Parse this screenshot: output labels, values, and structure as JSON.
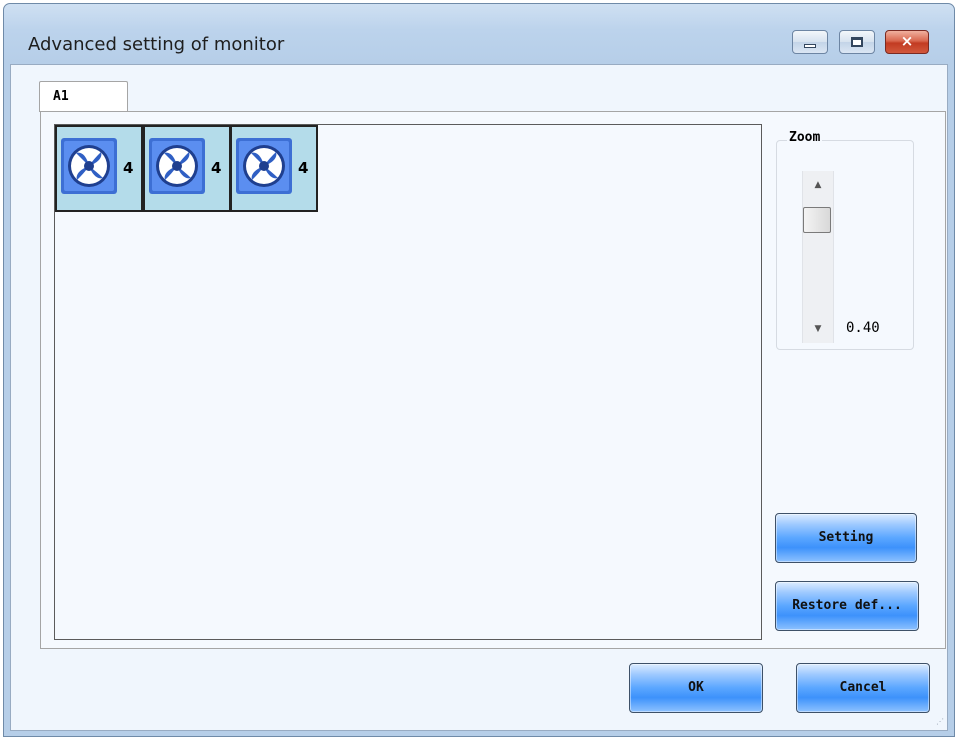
{
  "window": {
    "title": "Advanced setting of monitor",
    "controls": {
      "minimize": "minimize-icon",
      "maximize": "maximize-icon",
      "close": "×"
    }
  },
  "tabs": [
    {
      "label": "A1",
      "selected": true
    }
  ],
  "fans": [
    {
      "icon": "fan-icon",
      "count": "4"
    },
    {
      "icon": "fan-icon",
      "count": "4"
    },
    {
      "icon": "fan-icon",
      "count": "4"
    }
  ],
  "zoom": {
    "legend": "Zoom",
    "value": "0.40"
  },
  "buttons": {
    "setting": "Setting",
    "restore": "Restore def...",
    "ok": "OK",
    "cancel": "Cancel"
  },
  "colors": {
    "fan_cell_bg": "#b4dcea",
    "button_blue": "#3d92fb",
    "title_bar": "#bcd3ec"
  }
}
